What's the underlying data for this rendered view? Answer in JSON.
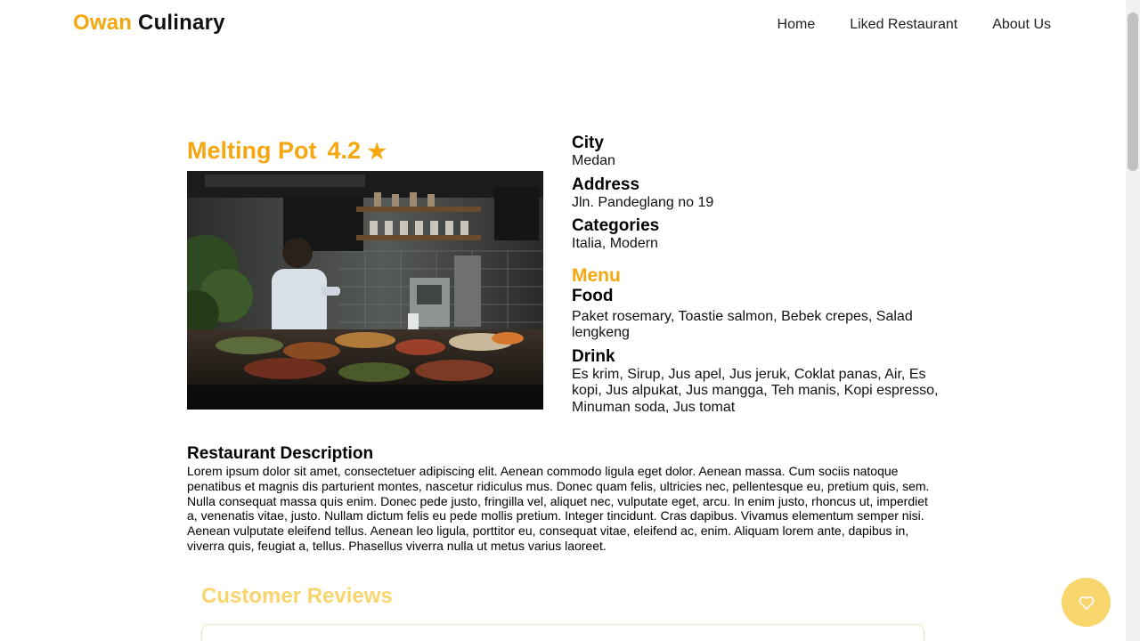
{
  "header": {
    "brand_accent": "Owan",
    "brand_rest": "Culinary",
    "nav": [
      "Home",
      "Liked Restaurant",
      "About Us"
    ]
  },
  "restaurant": {
    "name": "Melting Pot",
    "rating": "4.2",
    "rating_icon": "★",
    "image_alt": "Melting Pot"
  },
  "info": {
    "city_label": "City",
    "city": "Medan",
    "address_label": "Address",
    "address": "Jln. Pandeglang no 19",
    "categories_label": "Categories",
    "categories": "Italia, Modern",
    "menu_label": "Menu",
    "food_label": "Food",
    "food": "Paket rosemary, Toastie salmon, Bebek crepes, Salad lengkeng",
    "drink_label": "Drink",
    "drink": "Es krim, Sirup, Jus apel, Jus jeruk, Coklat panas, Air, Es kopi, Jus alpukat, Jus mangga, Teh manis, Kopi espresso, Minuman soda, Jus tomat"
  },
  "description": {
    "label": "Restaurant Description",
    "text": "Lorem ipsum dolor sit amet, consectetuer adipiscing elit. Aenean commodo ligula eget dolor. Aenean massa. Cum sociis natoque penatibus et magnis dis parturient montes, nascetur ridiculus mus. Donec quam felis, ultricies nec, pellentesque eu, pretium quis, sem. Nulla consequat massa quis enim. Donec pede justo, fringilla vel, aliquet nec, vulputate eget, arcu. In enim justo, rhoncus ut, imperdiet a, venenatis vitae, justo. Nullam dictum felis eu pede mollis pretium. Integer tincidunt. Cras dapibus. Vivamus elementum semper nisi. Aenean vulputate eleifend tellus. Aenean leo ligula, porttitor eu, consequat vitae, eleifend ac, enim. Aliquam lorem ante, dapibus in, viverra quis, feugiat a, tellus. Phasellus viverra nulla ut metus varius laoreet."
  },
  "reviews": {
    "title": "Customer Reviews"
  },
  "colors": {
    "accent": "#f5a70f",
    "accent_light": "#f9d56d"
  },
  "icons": {
    "favorite_button": "heart-icon",
    "rating": "star-icon"
  }
}
